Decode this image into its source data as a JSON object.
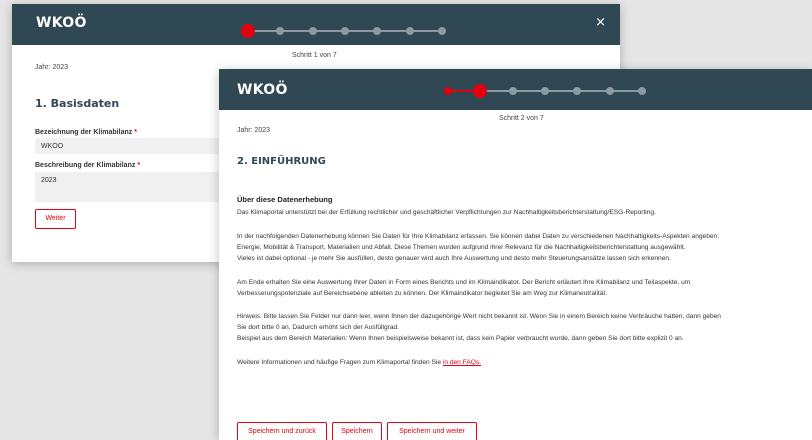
{
  "modal1": {
    "brand": "WKOÖ",
    "close_icon": "×",
    "step_label": "Schritt 1 von 7",
    "year": "Jahr: 2023",
    "section_title": "1. Basisdaten",
    "field1_label": "Bezeichnung der Klimabilanz",
    "field1_value": "WKOO",
    "field2_label": "Beschreibung der Klimabilanz",
    "field2_value": "2023",
    "required_mark": "*",
    "next_button": "Weiter",
    "current_step": 1,
    "total_steps": 7
  },
  "modal2": {
    "brand": "WKOÖ",
    "step_label": "Schritt 2 von 7",
    "year": "Jahr: 2023",
    "section_title": "2. EINFÜHRUNG",
    "subtitle": "Über diese Datenerhebung",
    "p1": "Das Klimaportal unterstützt bei der Erfüllung rechtlicher und geschäftlicher Verpflichtungen zur Nachhaltigkeitsberichterstattung/ESG-Reporting.",
    "p2_l1": "In der nachfolgenden Datenerhebung können Sie Daten für Ihre Klimabilanz erfassen. Sie können dabei Daten zu verschiedenen Nachhaltigkeits-Aspekten angeben:",
    "p2_l2": "Energie, Mobilität & Transport, Materialien und Abfall. Diese Themen wurden aufgrund ihrer Relevanz für die Nachhaltigkeitsberichterstattung ausgewählt.",
    "p2_l3": "Vieles ist dabei optional - je mehr Sie ausfüllen, desto genauer wird auch Ihre Auswertung und desto mehr Steuerungsansätze lassen sich erkennen.",
    "p3_l1": "Am Ende erhalten Sie eine Auswertung Ihrer Daten in Form eines Berichts und im Klimaindikator. Der Bericht erläutert Ihre Klimabilanz und Teilaspekte, um",
    "p3_l2": "Verbesserungspotenziale auf Bereichsebene ableiten zu können. Der Klimaindikator begleitet Sie am Weg zur Klimaneutralität.",
    "p4_l1": "Hinweis: Bitte lassen Sie Felder nur dann leer, wenn Ihnen der dazugehörige Wert nicht bekannt ist. Wenn Sie in einem Bereich keine Verbräuche hatten, dann geben",
    "p4_l2": "Sie dort bitte 0 an. Dadurch erhöht sich der Ausfüllgrad.",
    "p4_l3": "Beispiel aus dem Bereich Materialien: Wenn Ihnen beispielsweise bekannt ist, dass kein Papier verbraucht wurde, dann geben Sie dort bitte explizit 0 an.",
    "p5_prefix": "Weitere Informationen und häufige Fragen zum Klimaportal finden Sie ",
    "p5_link": "in den FAQs.",
    "btn_save_back": "Speichern und zurück",
    "btn_save": "Speichern",
    "btn_save_next": "Speichern und weiter",
    "current_step": 2,
    "total_steps": 7
  },
  "colors": {
    "header_bg": "#2f4853",
    "accent_red": "#e3000f",
    "step_inactive": "#8c9aa1"
  }
}
